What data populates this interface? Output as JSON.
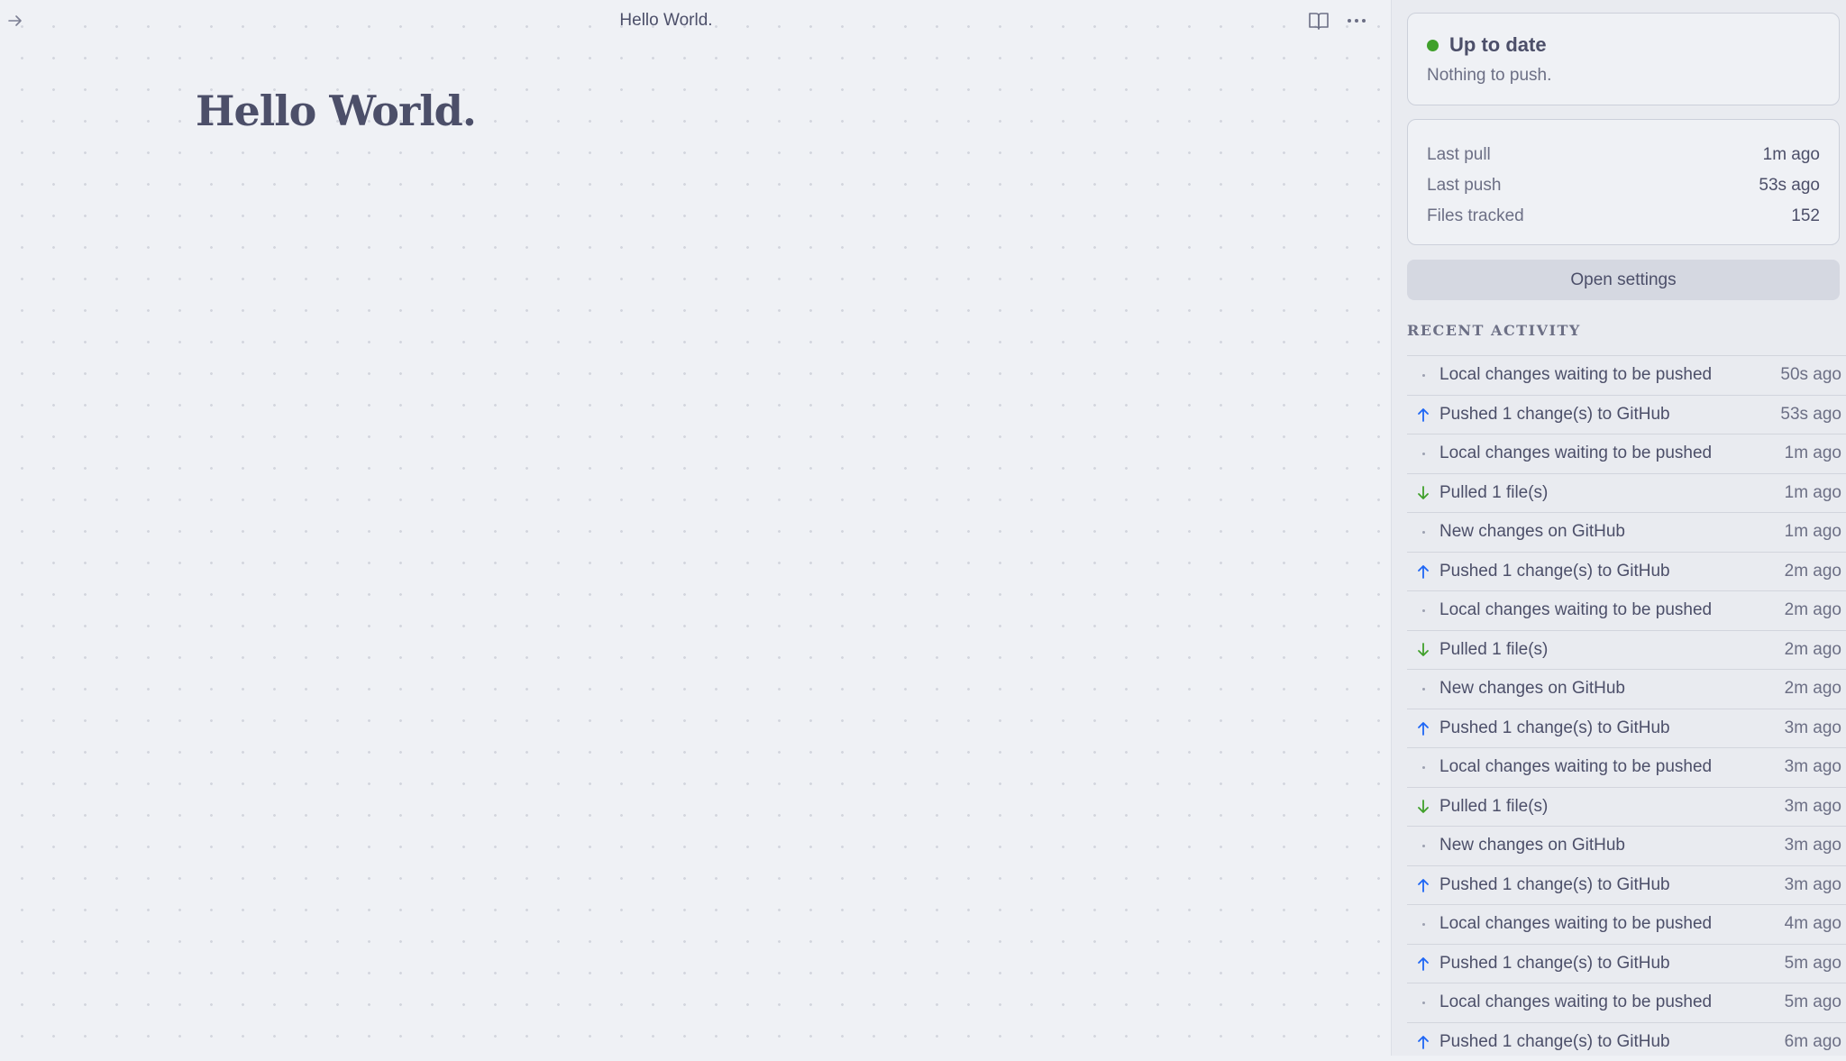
{
  "header": {
    "title": "Hello World."
  },
  "document": {
    "heading": "Hello World."
  },
  "status": {
    "title": "Up to date",
    "subtitle": "Nothing to push.",
    "color": "#40a02b"
  },
  "stats": [
    {
      "label": "Last pull",
      "value": "1m ago"
    },
    {
      "label": "Last push",
      "value": "53s ago"
    },
    {
      "label": "Files tracked",
      "value": "152"
    }
  ],
  "settings_label": "Open settings",
  "activity_heading": "RECENT ACTIVITY",
  "activity": [
    {
      "kind": "local",
      "text": "Local changes waiting to be pushed",
      "time": "50s ago"
    },
    {
      "kind": "push",
      "text": "Pushed 1 change(s) to GitHub",
      "time": "53s ago"
    },
    {
      "kind": "local",
      "text": "Local changes waiting to be pushed",
      "time": "1m ago"
    },
    {
      "kind": "pull",
      "text": "Pulled 1 file(s)",
      "time": "1m ago"
    },
    {
      "kind": "remote",
      "text": "New changes on GitHub",
      "time": "1m ago"
    },
    {
      "kind": "push",
      "text": "Pushed 1 change(s) to GitHub",
      "time": "2m ago"
    },
    {
      "kind": "local",
      "text": "Local changes waiting to be pushed",
      "time": "2m ago"
    },
    {
      "kind": "pull",
      "text": "Pulled 1 file(s)",
      "time": "2m ago"
    },
    {
      "kind": "remote",
      "text": "New changes on GitHub",
      "time": "2m ago"
    },
    {
      "kind": "push",
      "text": "Pushed 1 change(s) to GitHub",
      "time": "3m ago"
    },
    {
      "kind": "local",
      "text": "Local changes waiting to be pushed",
      "time": "3m ago"
    },
    {
      "kind": "pull",
      "text": "Pulled 1 file(s)",
      "time": "3m ago"
    },
    {
      "kind": "remote",
      "text": "New changes on GitHub",
      "time": "3m ago"
    },
    {
      "kind": "push",
      "text": "Pushed 1 change(s) to GitHub",
      "time": "3m ago"
    },
    {
      "kind": "local",
      "text": "Local changes waiting to be pushed",
      "time": "4m ago"
    },
    {
      "kind": "push",
      "text": "Pushed 1 change(s) to GitHub",
      "time": "5m ago"
    },
    {
      "kind": "local",
      "text": "Local changes waiting to be pushed",
      "time": "5m ago"
    },
    {
      "kind": "push",
      "text": "Pushed 1 change(s) to GitHub",
      "time": "6m ago"
    }
  ],
  "colors": {
    "push": "#1e66f5",
    "pull": "#40a02b",
    "neutral": "#9ca0b0"
  },
  "icons": {
    "nav": "arrow-right-icon",
    "reading_view": "book-open-icon",
    "more": "more-horizontal-icon",
    "push": "arrow-up-icon",
    "pull": "arrow-down-icon",
    "neutral": "dot-icon"
  }
}
